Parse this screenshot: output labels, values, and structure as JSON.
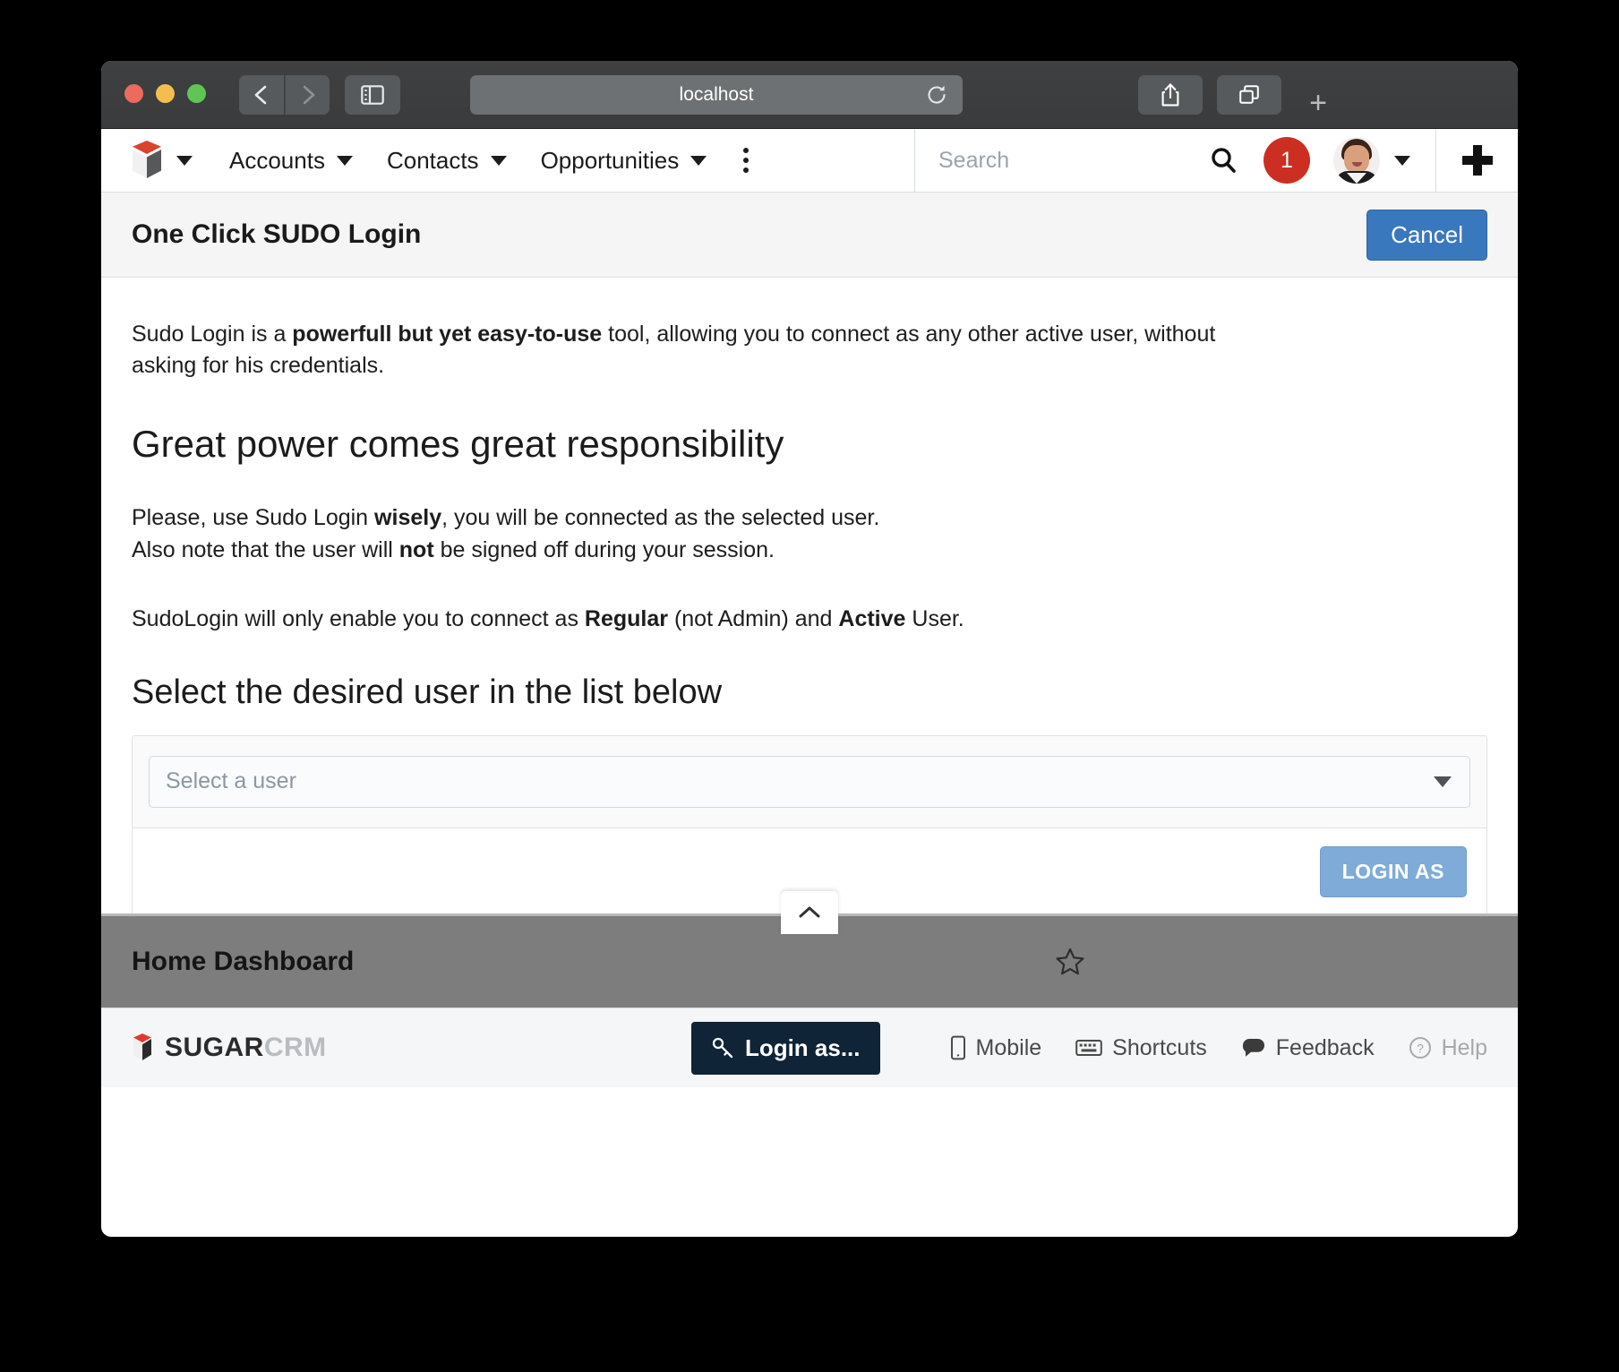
{
  "browser": {
    "url": "localhost",
    "back_icon": "chevron-left-icon",
    "forward_icon": "chevron-right-icon",
    "sidebar_icon": "sidebar-toggle-icon",
    "reload_icon": "reload-icon",
    "share_icon": "share-icon",
    "tabs_icon": "tab-overview-icon",
    "new_tab_label": "+"
  },
  "navbar": {
    "logo_icon": "sugarcrm-cube-logo",
    "modules": [
      {
        "label": "Accounts"
      },
      {
        "label": "Contacts"
      },
      {
        "label": "Opportunities"
      }
    ],
    "more_icon": "kebab-menu-icon",
    "search_placeholder": "Search",
    "search_value": "",
    "search_icon": "search-icon",
    "notification_count": "1",
    "avatar_icon": "user-avatar",
    "plus_icon": "plus-icon"
  },
  "header": {
    "title": "One Click SUDO Login",
    "cancel_label": "Cancel"
  },
  "content": {
    "intro_prefix": "Sudo Login is a ",
    "intro_bold": "powerfull but yet easy-to-use",
    "intro_suffix": " tool, allowing you to connect as any other active user, without asking for his credentials.",
    "heading_power": "Great power comes great responsibility",
    "usage_line1_prefix": "Please, use Sudo Login ",
    "usage_line1_bold": "wisely",
    "usage_line1_suffix": ", you will be connected as the selected user.",
    "usage_line2_prefix": "Also note that the user will ",
    "usage_line2_bold": "not",
    "usage_line2_suffix": " be signed off during your session.",
    "restriction_prefix": "SudoLogin will only enable you to connect as ",
    "restriction_bold1": "Regular",
    "restriction_mid": " (not Admin) and ",
    "restriction_bold2": "Active",
    "restriction_suffix": " User.",
    "heading_select": "Select the desired user in the list below",
    "select_placeholder": "Select a user",
    "select_caret_icon": "chevron-down-icon",
    "login_as_label": "LOGIN AS"
  },
  "dashboard": {
    "title": "Home Dashboard",
    "collapse_icon": "chevron-up-icon",
    "favorite_icon": "star-outline-icon"
  },
  "footer": {
    "logo_icon": "sugarcrm-cube-logo",
    "wordmark_primary": "SUGAR",
    "wordmark_secondary": "CRM",
    "login_as_label": "Login as...",
    "login_as_icon": "key-icon",
    "links": [
      {
        "label": "Mobile",
        "icon": "mobile-icon",
        "muted": false
      },
      {
        "label": "Shortcuts",
        "icon": "keyboard-icon",
        "muted": false
      },
      {
        "label": "Feedback",
        "icon": "comment-icon",
        "muted": false
      },
      {
        "label": "Help",
        "icon": "help-circle-icon",
        "muted": true
      }
    ]
  },
  "colors": {
    "accent_blue": "#3a78bd",
    "login_as_blue": "#7fabd8",
    "brand_red": "#d9442b",
    "notification_red": "#cc2f22",
    "footer_dark": "#0f2436"
  }
}
